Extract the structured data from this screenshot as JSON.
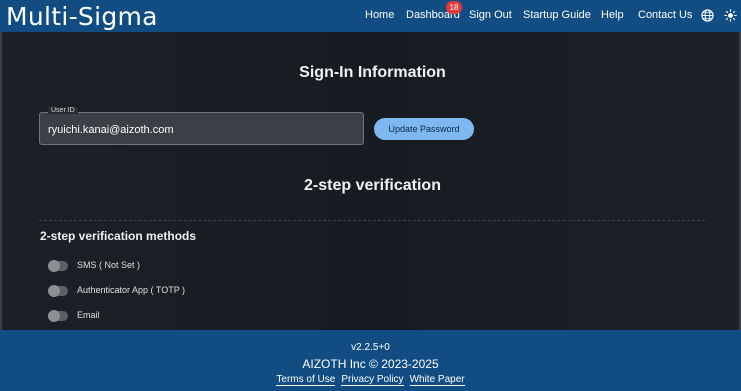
{
  "header": {
    "logo": "Multi-Sigma",
    "nav": {
      "home": "Home",
      "dashboard": "Dashboard",
      "dashboard_badge": "18",
      "sign_out": "Sign Out",
      "startup_guide": "Startup Guide",
      "help": "Help",
      "contact_us": "Contact Us"
    },
    "icons": [
      "globe-icon",
      "sun-icon"
    ]
  },
  "sign_in": {
    "title": "Sign-In Information",
    "user_id_label": "User ID",
    "user_id_value": "ryuichi.kanai@aizoth.com",
    "update_password_label": "Update Password"
  },
  "two_step": {
    "title": "2-step verification",
    "methods_title": "2-step verification methods",
    "methods": [
      {
        "label": "SMS ( Not Set )",
        "enabled": false
      },
      {
        "label": "Authenticator App ( TOTP )",
        "enabled": false
      },
      {
        "label": "Email",
        "enabled": false
      }
    ]
  },
  "footer": {
    "version": "v2.2.5+0",
    "copyright": "AIZOTH Inc © 2023-2025",
    "links": {
      "terms": "Terms of Use",
      "privacy": "Privacy Policy",
      "white_paper": "White Paper"
    }
  },
  "colors": {
    "header_bg": "#114d82",
    "page_bg": "#141a1f",
    "accent_button": "#7eb8f0",
    "badge": "#e53935"
  }
}
